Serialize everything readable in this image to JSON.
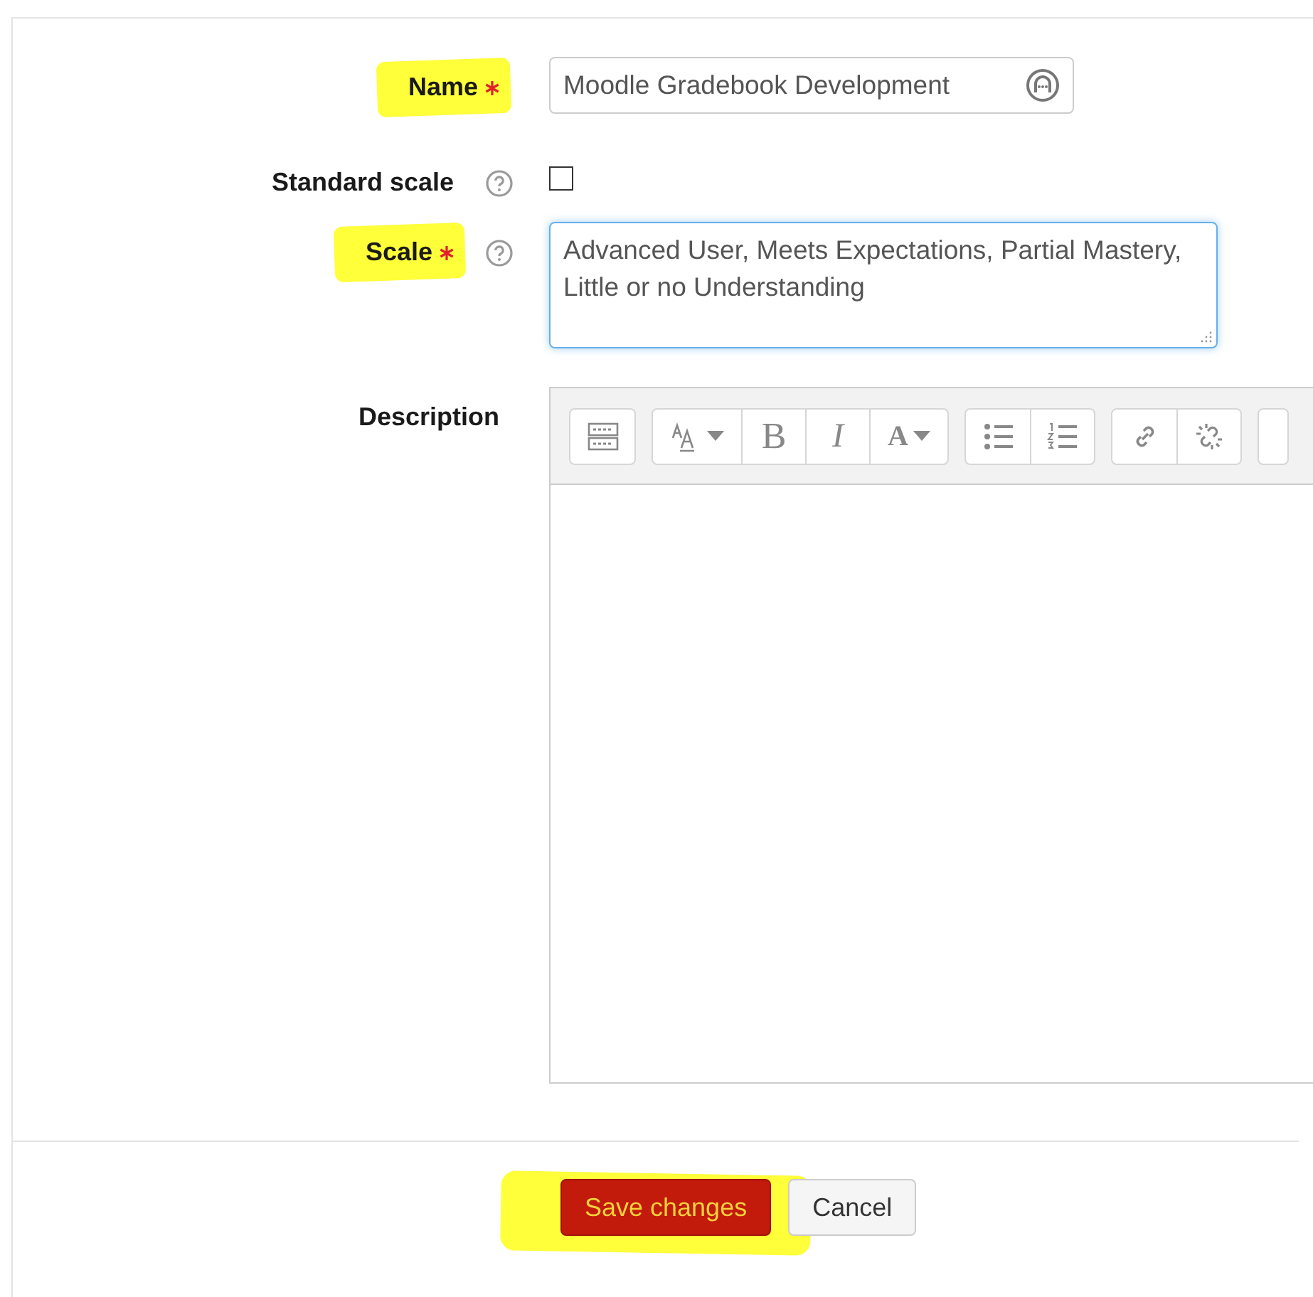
{
  "form": {
    "fields": [
      {
        "kind": "text",
        "label": "Name",
        "required": true,
        "help": false,
        "highlighted": true,
        "value": "Moodle Gradebook Development"
      },
      {
        "kind": "checkbox",
        "label": "Standard scale",
        "required": false,
        "help": true,
        "highlighted": false,
        "checked": false
      },
      {
        "kind": "textarea",
        "label": "Scale",
        "required": true,
        "help": true,
        "highlighted": true,
        "focused": true,
        "value": "Advanced User, Meets Expectations, Partial Mastery, Little or no Understanding"
      },
      {
        "kind": "editor",
        "label": "Description",
        "required": false,
        "help": false,
        "highlighted": false,
        "toolbar": [
          [
            {
              "kind": "icon"
            }
          ],
          [
            {
              "kind": "icon",
              "dropdown": true
            },
            {
              "kind": "glyph",
              "text": "B"
            },
            {
              "kind": "glyph",
              "text": "I"
            },
            {
              "kind": "glyph",
              "text": "A",
              "dropdown": true
            }
          ],
          [
            {
              "kind": "icon"
            },
            {
              "kind": "icon"
            }
          ],
          [
            {
              "kind": "icon"
            },
            {
              "kind": "icon"
            }
          ],
          [
            {
              "kind": "partial"
            }
          ]
        ]
      }
    ]
  },
  "buttons": [
    {
      "label": "Save changes",
      "kind": "primary",
      "highlighted": true
    },
    {
      "label": "Cancel",
      "kind": "secondary",
      "highlighted": false
    }
  ]
}
